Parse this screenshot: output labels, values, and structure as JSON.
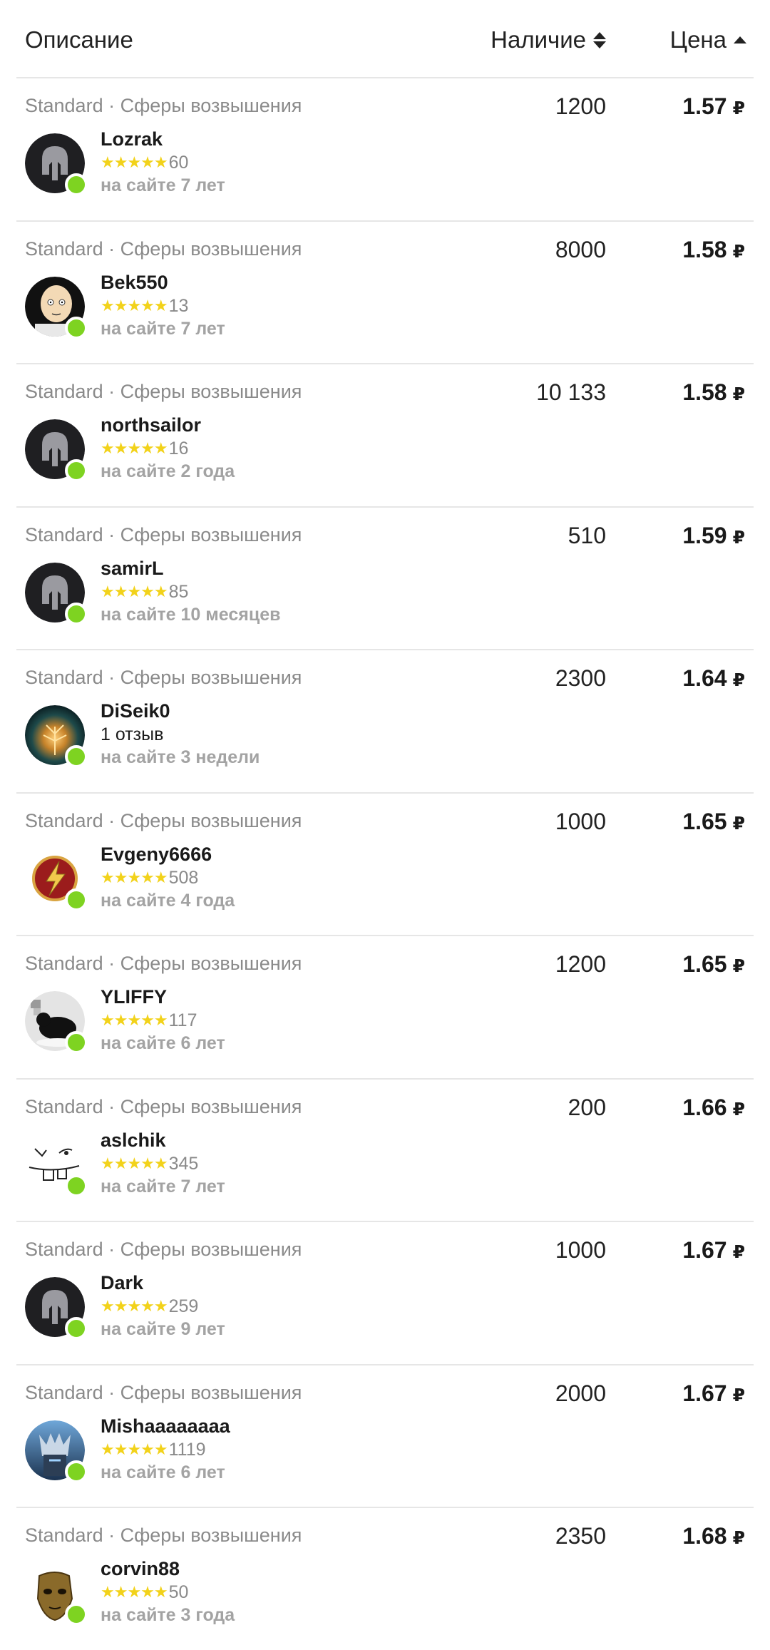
{
  "header": {
    "description": "Описание",
    "stock": "Наличие",
    "price": "Цена"
  },
  "currency": "₽",
  "colors": {
    "online": "#7ed321",
    "star": "#f2d21a"
  },
  "rows": [
    {
      "desc": "Standard · Сферы возвышения",
      "stock": "1200",
      "price": "1.57",
      "name": "Lozrak",
      "stars": "★★★★★",
      "reviews": "60",
      "age": "на сайте 7 лет",
      "avatar": "helmet-avatar"
    },
    {
      "desc": "Standard · Сферы возвышения",
      "stock": "8000",
      "price": "1.58",
      "name": "Bek550",
      "stars": "★★★★★",
      "reviews": "13",
      "age": "на сайте 7 лет",
      "avatar": "bald-face-avatar"
    },
    {
      "desc": "Standard · Сферы возвышения",
      "stock": "10 133",
      "price": "1.58",
      "name": "northsailor",
      "stars": "★★★★★",
      "reviews": "16",
      "age": "на сайте 2 года",
      "avatar": "helmet-avatar"
    },
    {
      "desc": "Standard · Сферы возвышения",
      "stock": "510",
      "price": "1.59",
      "name": "samirL",
      "stars": "★★★★★",
      "reviews": "85",
      "age": "на сайте 10 месяцев",
      "avatar": "helmet-avatar"
    },
    {
      "desc": "Standard · Сферы возвышения",
      "stock": "2300",
      "price": "1.64",
      "name": "DiSeik0",
      "stars": "",
      "reviews": "1 отзыв",
      "age": "на сайте 3 недели",
      "avatar": "glowing-tree-avatar"
    },
    {
      "desc": "Standard · Сферы возвышения",
      "stock": "1000",
      "price": "1.65",
      "name": "Evgeny6666",
      "stars": "★★★★★",
      "reviews": "508",
      "age": "на сайте 4 года",
      "avatar": "lightning-emblem-avatar"
    },
    {
      "desc": "Standard · Сферы возвышения",
      "stock": "1200",
      "price": "1.65",
      "name": "YLIFFY",
      "stars": "★★★★★",
      "reviews": "117",
      "age": "на сайте 6 лет",
      "avatar": "black-cat-avatar"
    },
    {
      "desc": "Standard · Сферы возвышения",
      "stock": "200",
      "price": "1.66",
      "name": "aslchik",
      "stars": "★★★★★",
      "reviews": "345",
      "age": "на сайте 7 лет",
      "avatar": "doodle-face-avatar"
    },
    {
      "desc": "Standard · Сферы возвышения",
      "stock": "1000",
      "price": "1.67",
      "name": "Dark",
      "stars": "★★★★★",
      "reviews": "259",
      "age": "на сайте 9 лет",
      "avatar": "helmet-avatar"
    },
    {
      "desc": "Standard · Сферы возвышения",
      "stock": "2000",
      "price": "1.67",
      "name": "Mishaaaaaaaa",
      "stars": "★★★★★",
      "reviews": "1119",
      "age": "на сайте 6 лет",
      "avatar": "armored-knight-avatar"
    },
    {
      "desc": "Standard · Сферы возвышения",
      "stock": "2350",
      "price": "1.68",
      "name": "corvin88",
      "stars": "★★★★★",
      "reviews": "50",
      "age": "на сайте 3 года",
      "avatar": "golden-mask-avatar"
    }
  ]
}
